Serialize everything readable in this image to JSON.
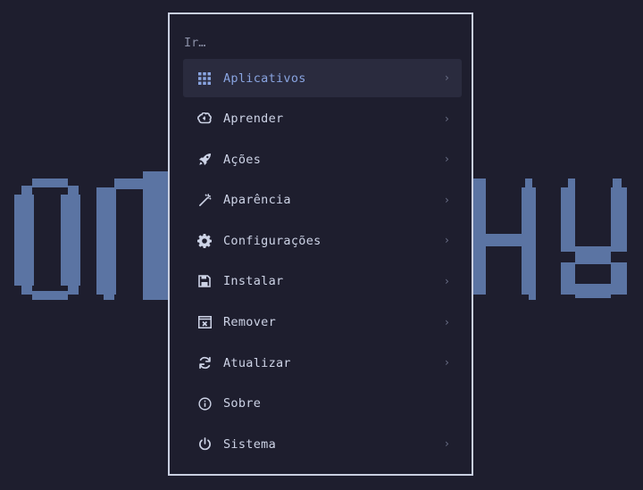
{
  "colors": {
    "background": "#1e1e2e",
    "menu_border": "#c9cfe0",
    "selected_bg": "#2a2b3e",
    "accent": "#89a4e0",
    "text": "#cdd3e6",
    "muted": "#8a8fa6",
    "logo": "#5b74a3"
  },
  "search": {
    "placeholder": "Ir…"
  },
  "menu": {
    "items": [
      {
        "label": "Aplicativos",
        "icon": "grid-icon",
        "selected": true,
        "chevron": "›"
      },
      {
        "label": "Aprender",
        "icon": "brain-icon",
        "selected": false,
        "chevron": "›"
      },
      {
        "label": "Ações",
        "icon": "rocket-icon",
        "selected": false,
        "chevron": "›"
      },
      {
        "label": "Aparência",
        "icon": "magic-wand-icon",
        "selected": false,
        "chevron": "›"
      },
      {
        "label": "Configurações",
        "icon": "gear-icon",
        "selected": false,
        "chevron": "›"
      },
      {
        "label": "Instalar",
        "icon": "floppy-disk-icon",
        "selected": false,
        "chevron": "›"
      },
      {
        "label": "Remover",
        "icon": "window-close-icon",
        "selected": false,
        "chevron": "›"
      },
      {
        "label": "Atualizar",
        "icon": "refresh-icon",
        "selected": false,
        "chevron": "›"
      },
      {
        "label": "Sobre",
        "icon": "info-icon",
        "selected": false,
        "chevron": ""
      },
      {
        "label": "Sistema",
        "icon": "power-icon",
        "selected": false,
        "chevron": "›"
      }
    ]
  }
}
